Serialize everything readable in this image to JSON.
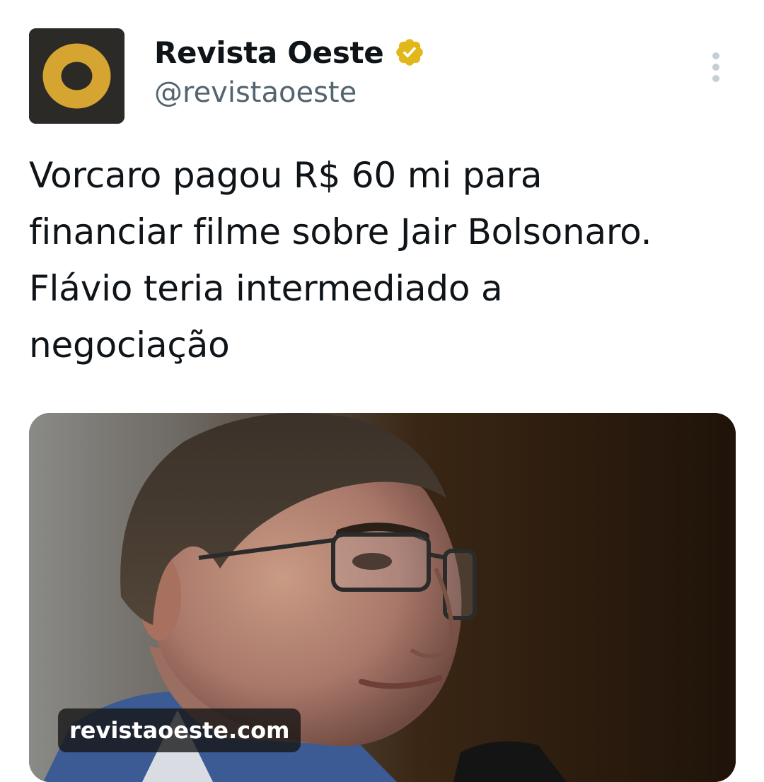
{
  "author": {
    "display_name": "Revista Oeste",
    "handle": "@revistaoeste",
    "verified": true,
    "avatar_icon": "revista-oeste-o-logo",
    "avatar_colors": {
      "background": "#2c2a27",
      "ring": "#d6a531"
    }
  },
  "icons": {
    "verified": "verified-badge-icon",
    "more": "more-vertical-icon"
  },
  "tweet": {
    "text_lines": [
      "Vorcaro pagou R$ 60 mi para",
      "financiar filme sobre Jair Bolsonaro.",
      "Flávio teria intermediado a",
      "negociação"
    ]
  },
  "media": {
    "domain": "revistaoeste.com",
    "image_subject": "close-up photo of a man in glasses and blue suit with a microphone"
  },
  "colors": {
    "text_primary": "#0f1419",
    "text_secondary": "#536471",
    "verified_gold": "#e2b719"
  }
}
